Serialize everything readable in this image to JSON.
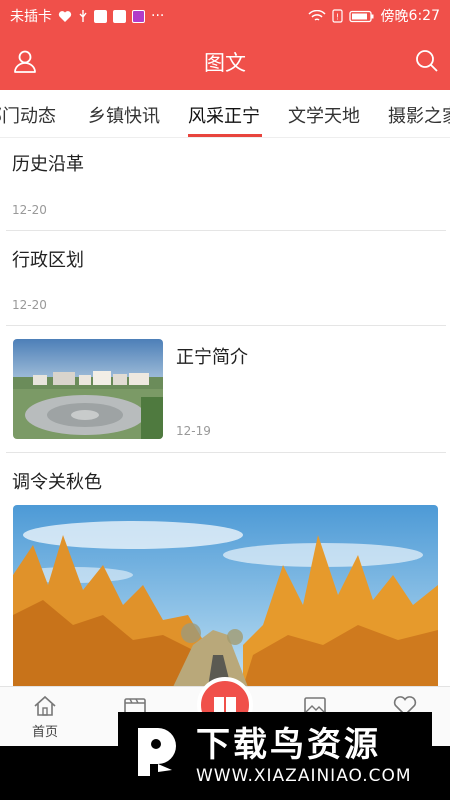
{
  "status_bar": {
    "carrier": "未插卡",
    "time_prefix": "傍晚",
    "time": "6:27",
    "more": "···"
  },
  "app_bar": {
    "title": "图文"
  },
  "tabs": [
    {
      "label": "部门动态"
    },
    {
      "label": "乡镇快讯"
    },
    {
      "label": "风采正宁",
      "active": true
    },
    {
      "label": "文学天地"
    },
    {
      "label": "摄影之家"
    }
  ],
  "articles": [
    {
      "title": "历史沿革",
      "date": "12-20"
    },
    {
      "title": "行政区划",
      "date": "12-20"
    },
    {
      "title": "正宁简介",
      "date": "12-19"
    },
    {
      "title": "调令关秋色"
    }
  ],
  "bottom_nav": [
    {
      "label": "首页",
      "icon": "home-icon"
    },
    {
      "label": "",
      "icon": "video-icon"
    },
    {
      "label": "",
      "icon": "book-icon"
    },
    {
      "label": "",
      "icon": "image-icon"
    },
    {
      "label": "",
      "icon": "heart-icon"
    }
  ],
  "watermark": {
    "brand": "下载鸟资源",
    "url": "WWW.XIAZAINIAO.COM"
  },
  "colors": {
    "primary": "#f0504a",
    "tab_indicator": "#e8443d"
  }
}
